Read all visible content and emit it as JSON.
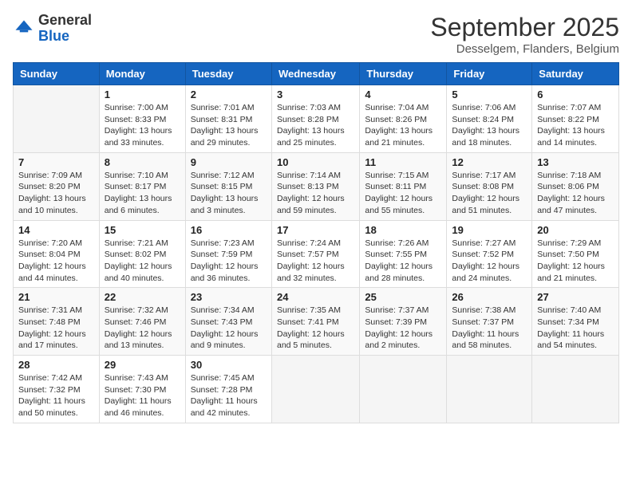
{
  "header": {
    "logo_general": "General",
    "logo_blue": "Blue",
    "month_year": "September 2025",
    "location": "Desselgem, Flanders, Belgium"
  },
  "days_of_week": [
    "Sunday",
    "Monday",
    "Tuesday",
    "Wednesday",
    "Thursday",
    "Friday",
    "Saturday"
  ],
  "weeks": [
    [
      {
        "day": "",
        "sunrise": "",
        "sunset": "",
        "daylight": ""
      },
      {
        "day": "1",
        "sunrise": "Sunrise: 7:00 AM",
        "sunset": "Sunset: 8:33 PM",
        "daylight": "Daylight: 13 hours and 33 minutes."
      },
      {
        "day": "2",
        "sunrise": "Sunrise: 7:01 AM",
        "sunset": "Sunset: 8:31 PM",
        "daylight": "Daylight: 13 hours and 29 minutes."
      },
      {
        "day": "3",
        "sunrise": "Sunrise: 7:03 AM",
        "sunset": "Sunset: 8:28 PM",
        "daylight": "Daylight: 13 hours and 25 minutes."
      },
      {
        "day": "4",
        "sunrise": "Sunrise: 7:04 AM",
        "sunset": "Sunset: 8:26 PM",
        "daylight": "Daylight: 13 hours and 21 minutes."
      },
      {
        "day": "5",
        "sunrise": "Sunrise: 7:06 AM",
        "sunset": "Sunset: 8:24 PM",
        "daylight": "Daylight: 13 hours and 18 minutes."
      },
      {
        "day": "6",
        "sunrise": "Sunrise: 7:07 AM",
        "sunset": "Sunset: 8:22 PM",
        "daylight": "Daylight: 13 hours and 14 minutes."
      }
    ],
    [
      {
        "day": "7",
        "sunrise": "Sunrise: 7:09 AM",
        "sunset": "Sunset: 8:20 PM",
        "daylight": "Daylight: 13 hours and 10 minutes."
      },
      {
        "day": "8",
        "sunrise": "Sunrise: 7:10 AM",
        "sunset": "Sunset: 8:17 PM",
        "daylight": "Daylight: 13 hours and 6 minutes."
      },
      {
        "day": "9",
        "sunrise": "Sunrise: 7:12 AM",
        "sunset": "Sunset: 8:15 PM",
        "daylight": "Daylight: 13 hours and 3 minutes."
      },
      {
        "day": "10",
        "sunrise": "Sunrise: 7:14 AM",
        "sunset": "Sunset: 8:13 PM",
        "daylight": "Daylight: 12 hours and 59 minutes."
      },
      {
        "day": "11",
        "sunrise": "Sunrise: 7:15 AM",
        "sunset": "Sunset: 8:11 PM",
        "daylight": "Daylight: 12 hours and 55 minutes."
      },
      {
        "day": "12",
        "sunrise": "Sunrise: 7:17 AM",
        "sunset": "Sunset: 8:08 PM",
        "daylight": "Daylight: 12 hours and 51 minutes."
      },
      {
        "day": "13",
        "sunrise": "Sunrise: 7:18 AM",
        "sunset": "Sunset: 8:06 PM",
        "daylight": "Daylight: 12 hours and 47 minutes."
      }
    ],
    [
      {
        "day": "14",
        "sunrise": "Sunrise: 7:20 AM",
        "sunset": "Sunset: 8:04 PM",
        "daylight": "Daylight: 12 hours and 44 minutes."
      },
      {
        "day": "15",
        "sunrise": "Sunrise: 7:21 AM",
        "sunset": "Sunset: 8:02 PM",
        "daylight": "Daylight: 12 hours and 40 minutes."
      },
      {
        "day": "16",
        "sunrise": "Sunrise: 7:23 AM",
        "sunset": "Sunset: 7:59 PM",
        "daylight": "Daylight: 12 hours and 36 minutes."
      },
      {
        "day": "17",
        "sunrise": "Sunrise: 7:24 AM",
        "sunset": "Sunset: 7:57 PM",
        "daylight": "Daylight: 12 hours and 32 minutes."
      },
      {
        "day": "18",
        "sunrise": "Sunrise: 7:26 AM",
        "sunset": "Sunset: 7:55 PM",
        "daylight": "Daylight: 12 hours and 28 minutes."
      },
      {
        "day": "19",
        "sunrise": "Sunrise: 7:27 AM",
        "sunset": "Sunset: 7:52 PM",
        "daylight": "Daylight: 12 hours and 24 minutes."
      },
      {
        "day": "20",
        "sunrise": "Sunrise: 7:29 AM",
        "sunset": "Sunset: 7:50 PM",
        "daylight": "Daylight: 12 hours and 21 minutes."
      }
    ],
    [
      {
        "day": "21",
        "sunrise": "Sunrise: 7:31 AM",
        "sunset": "Sunset: 7:48 PM",
        "daylight": "Daylight: 12 hours and 17 minutes."
      },
      {
        "day": "22",
        "sunrise": "Sunrise: 7:32 AM",
        "sunset": "Sunset: 7:46 PM",
        "daylight": "Daylight: 12 hours and 13 minutes."
      },
      {
        "day": "23",
        "sunrise": "Sunrise: 7:34 AM",
        "sunset": "Sunset: 7:43 PM",
        "daylight": "Daylight: 12 hours and 9 minutes."
      },
      {
        "day": "24",
        "sunrise": "Sunrise: 7:35 AM",
        "sunset": "Sunset: 7:41 PM",
        "daylight": "Daylight: 12 hours and 5 minutes."
      },
      {
        "day": "25",
        "sunrise": "Sunrise: 7:37 AM",
        "sunset": "Sunset: 7:39 PM",
        "daylight": "Daylight: 12 hours and 2 minutes."
      },
      {
        "day": "26",
        "sunrise": "Sunrise: 7:38 AM",
        "sunset": "Sunset: 7:37 PM",
        "daylight": "Daylight: 11 hours and 58 minutes."
      },
      {
        "day": "27",
        "sunrise": "Sunrise: 7:40 AM",
        "sunset": "Sunset: 7:34 PM",
        "daylight": "Daylight: 11 hours and 54 minutes."
      }
    ],
    [
      {
        "day": "28",
        "sunrise": "Sunrise: 7:42 AM",
        "sunset": "Sunset: 7:32 PM",
        "daylight": "Daylight: 11 hours and 50 minutes."
      },
      {
        "day": "29",
        "sunrise": "Sunrise: 7:43 AM",
        "sunset": "Sunset: 7:30 PM",
        "daylight": "Daylight: 11 hours and 46 minutes."
      },
      {
        "day": "30",
        "sunrise": "Sunrise: 7:45 AM",
        "sunset": "Sunset: 7:28 PM",
        "daylight": "Daylight: 11 hours and 42 minutes."
      },
      {
        "day": "",
        "sunrise": "",
        "sunset": "",
        "daylight": ""
      },
      {
        "day": "",
        "sunrise": "",
        "sunset": "",
        "daylight": ""
      },
      {
        "day": "",
        "sunrise": "",
        "sunset": "",
        "daylight": ""
      },
      {
        "day": "",
        "sunrise": "",
        "sunset": "",
        "daylight": ""
      }
    ]
  ]
}
